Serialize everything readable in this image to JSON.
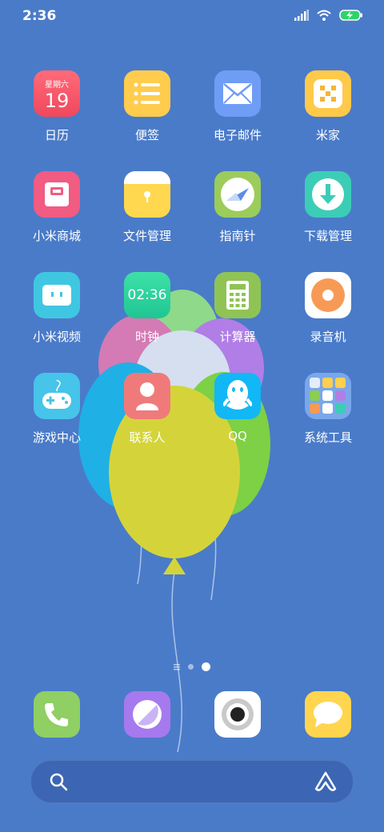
{
  "status": {
    "time": "2:36"
  },
  "apps": [
    {
      "id": "calendar",
      "label": "日历",
      "weekday": "星期六",
      "day": "19",
      "color": "#f25b6a"
    },
    {
      "id": "notes",
      "label": "便签",
      "color": "#ffc94a"
    },
    {
      "id": "email",
      "label": "电子邮件",
      "color": "#6b99f2"
    },
    {
      "id": "mihome",
      "label": "米家",
      "color": "#ffc94a"
    },
    {
      "id": "mall",
      "label": "小米商城",
      "color": "#f0587a"
    },
    {
      "id": "files",
      "label": "文件管理",
      "color": "#ffd34e"
    },
    {
      "id": "compass",
      "label": "指南针",
      "color": "#9acd55"
    },
    {
      "id": "downloads",
      "label": "下载管理",
      "color": "#3ccbb5"
    },
    {
      "id": "video",
      "label": "小米视频",
      "color": "#3ec6e0"
    },
    {
      "id": "clock",
      "label": "时钟",
      "clock_time": "02:36",
      "color": "#27d3a0"
    },
    {
      "id": "calculator",
      "label": "计算器",
      "color": "#8cc152"
    },
    {
      "id": "recorder",
      "label": "录音机",
      "color": "#ffffff"
    },
    {
      "id": "games",
      "label": "游戏中心",
      "color": "#45c2e8"
    },
    {
      "id": "contacts",
      "label": "联系人",
      "color": "#f07878"
    },
    {
      "id": "qq",
      "label": "QQ",
      "color": "#12b7f5"
    },
    {
      "id": "tools",
      "label": "系统工具",
      "color": "#6ea0e6"
    }
  ],
  "dock": [
    {
      "id": "phone",
      "color": "#8cd066"
    },
    {
      "id": "browser",
      "color": "#a477ec"
    },
    {
      "id": "camera",
      "color": "#ffffff"
    },
    {
      "id": "messages",
      "color": "#ffd54f"
    }
  ],
  "page_indicator": {
    "current": 2
  }
}
